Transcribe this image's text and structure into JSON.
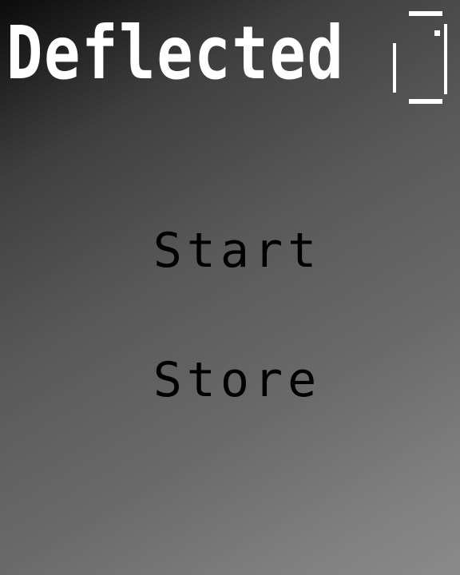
{
  "game": {
    "title": "Deflected",
    "logo_icon": "paddle-ball-icon"
  },
  "menu": {
    "items": [
      {
        "label": "Start"
      },
      {
        "label": "Store"
      }
    ]
  },
  "colors": {
    "title_text": "#ffffff",
    "menu_text": "#000000",
    "background_dark": "#0b0b0b",
    "background_light": "#8a8a8a"
  }
}
